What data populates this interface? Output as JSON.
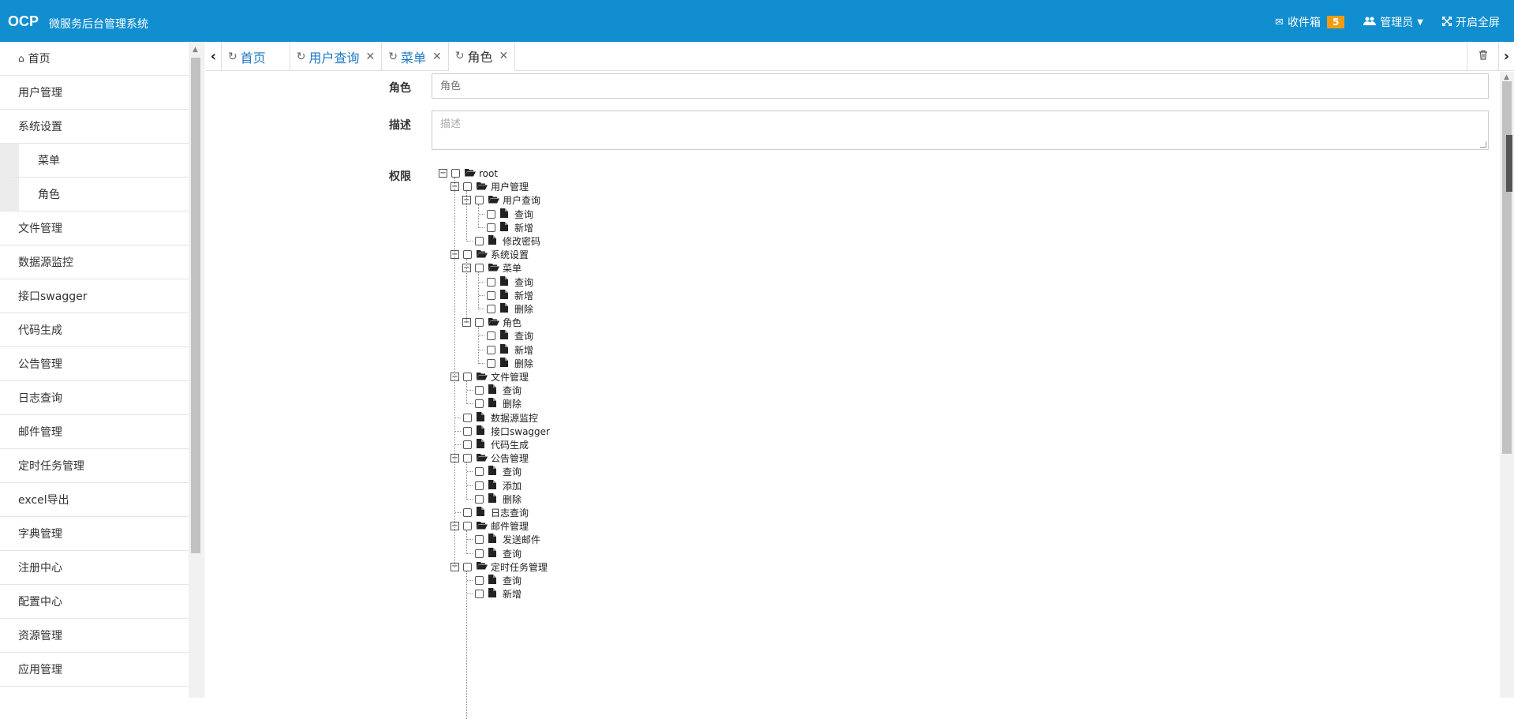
{
  "header": {
    "logo": "OCP",
    "title": "微服务后台管理系统",
    "inbox_label": "收件箱",
    "inbox_count": "5",
    "admin_label": "管理员",
    "fullscreen_label": "开启全屏"
  },
  "sidebar": {
    "items": [
      {
        "label": "首页",
        "sub": false,
        "icon": "home-icon"
      },
      {
        "label": "用户管理",
        "sub": false
      },
      {
        "label": "系统设置",
        "sub": false
      },
      {
        "label": "菜单",
        "sub": true
      },
      {
        "label": "角色",
        "sub": true
      },
      {
        "label": "文件管理",
        "sub": false
      },
      {
        "label": "数据源监控",
        "sub": false
      },
      {
        "label": "接口swagger",
        "sub": false
      },
      {
        "label": "代码生成",
        "sub": false
      },
      {
        "label": "公告管理",
        "sub": false
      },
      {
        "label": "日志查询",
        "sub": false
      },
      {
        "label": "邮件管理",
        "sub": false
      },
      {
        "label": "定时任务管理",
        "sub": false
      },
      {
        "label": "excel导出",
        "sub": false
      },
      {
        "label": "字典管理",
        "sub": false
      },
      {
        "label": "注册中心",
        "sub": false
      },
      {
        "label": "配置中心",
        "sub": false
      },
      {
        "label": "资源管理",
        "sub": false
      },
      {
        "label": "应用管理",
        "sub": false
      }
    ]
  },
  "tabs": [
    {
      "label": "首页",
      "closable": false,
      "active": false
    },
    {
      "label": "用户查询",
      "closable": true,
      "active": false
    },
    {
      "label": "菜单",
      "closable": true,
      "active": false
    },
    {
      "label": "角色",
      "closable": true,
      "active": true
    }
  ],
  "form": {
    "role_label": "角色",
    "role_placeholder": "角色",
    "desc_label": "描述",
    "desc_placeholder": "描述",
    "perm_label": "权限"
  },
  "tree": [
    {
      "label": "root",
      "level": 0,
      "type": "folder"
    },
    {
      "label": "用户管理",
      "level": 1,
      "type": "folder"
    },
    {
      "label": "用户查询",
      "level": 2,
      "type": "folder"
    },
    {
      "label": "查询",
      "level": 3,
      "type": "file"
    },
    {
      "label": "新增",
      "level": 3,
      "type": "file"
    },
    {
      "label": "修改密码",
      "level": 2,
      "type": "file"
    },
    {
      "label": "系统设置",
      "level": 1,
      "type": "folder"
    },
    {
      "label": "菜单",
      "level": 2,
      "type": "folder"
    },
    {
      "label": "查询",
      "level": 3,
      "type": "file"
    },
    {
      "label": "新增",
      "level": 3,
      "type": "file"
    },
    {
      "label": "删除",
      "level": 3,
      "type": "file"
    },
    {
      "label": "角色",
      "level": 2,
      "type": "folder"
    },
    {
      "label": "查询",
      "level": 3,
      "type": "file"
    },
    {
      "label": "新增",
      "level": 3,
      "type": "file"
    },
    {
      "label": "删除",
      "level": 3,
      "type": "file"
    },
    {
      "label": "文件管理",
      "level": 1,
      "type": "folder"
    },
    {
      "label": "查询",
      "level": 2,
      "type": "file"
    },
    {
      "label": "删除",
      "level": 2,
      "type": "file"
    },
    {
      "label": "数据源监控",
      "level": 1,
      "type": "file"
    },
    {
      "label": "接口swagger",
      "level": 1,
      "type": "file"
    },
    {
      "label": "代码生成",
      "level": 1,
      "type": "file"
    },
    {
      "label": "公告管理",
      "level": 1,
      "type": "folder"
    },
    {
      "label": "查询",
      "level": 2,
      "type": "file"
    },
    {
      "label": "添加",
      "level": 2,
      "type": "file"
    },
    {
      "label": "删除",
      "level": 2,
      "type": "file"
    },
    {
      "label": "日志查询",
      "level": 1,
      "type": "file"
    },
    {
      "label": "邮件管理",
      "level": 1,
      "type": "folder"
    },
    {
      "label": "发送邮件",
      "level": 2,
      "type": "file"
    },
    {
      "label": "查询",
      "level": 2,
      "type": "file"
    },
    {
      "label": "定时任务管理",
      "level": 1,
      "type": "folder"
    },
    {
      "label": "查询",
      "level": 2,
      "type": "file"
    },
    {
      "label": "新增",
      "level": 2,
      "type": "file"
    }
  ]
}
